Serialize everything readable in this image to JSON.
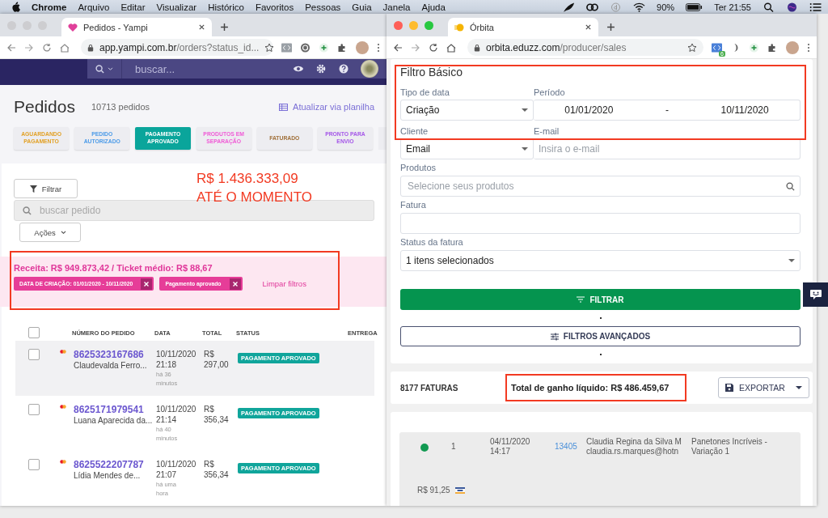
{
  "menu_bar": {
    "app": "Chrome",
    "items": [
      "Arquivo",
      "Editar",
      "Visualizar",
      "Histórico",
      "Favoritos",
      "Pessoas",
      "Guia",
      "Janela",
      "Ajuda"
    ],
    "battery": "90%",
    "clock": "Ter 21:55"
  },
  "left_window": {
    "tab": {
      "title": "Pedidos - Yampi"
    },
    "url": {
      "host": "app.yampi.com.br",
      "path": "/orders?status_id..."
    },
    "header": {
      "search_placeholder": "buscar..."
    },
    "page": {
      "title": "Pedidos",
      "count": "10713 pedidos",
      "sheet_link": "Atualizar via planilha"
    },
    "status_tabs": [
      {
        "label": "AGUARDANDO PAGAMENTO",
        "color": "#e2a126",
        "selected": false
      },
      {
        "label": "PEDIDO AUTORIZADO",
        "color": "#4c9be8",
        "selected": false
      },
      {
        "label": "PAGAMENTO APROVADO",
        "color": "#0aa59b",
        "selected": true
      },
      {
        "label": "PRODUTOS EM SEPARAÇÃO",
        "color": "#f05ad6",
        "selected": false
      },
      {
        "label": "FATURADO",
        "color": "#a0703a",
        "selected": false
      },
      {
        "label": "PRONTO PARA ENVIO",
        "color": "#a455e8",
        "selected": false
      }
    ],
    "filter_button": "Filtrar",
    "search": {
      "placeholder": "buscar pedido"
    },
    "actions_button": "Ações",
    "summary": {
      "text": "Receita: R$ 949.873,42 / Ticket médio: R$ 88,67",
      "chips": [
        "DATA DE CRIAÇÃO: 01/01/2020 - 10/11/2020",
        "Pagamento aprovado"
      ],
      "clear": "Limpar filtros"
    },
    "table": {
      "columns": [
        "NÚMERO DO PEDIDO",
        "DATA",
        "TOTAL",
        "STATUS",
        "ENTREGA"
      ],
      "all_checked": false,
      "rows": [
        {
          "number": "8625323167686",
          "customer": "Claudevalda Ferro...",
          "date": "10/11/2020",
          "time": "21:18",
          "ago": "há 36 minutos",
          "currency": "R$",
          "total": "297,00",
          "status": "PAGAMENTO APROVADO",
          "checked": false,
          "highlighted": true
        },
        {
          "number": "8625171979541",
          "customer": "Luana Aparecida da...",
          "date": "10/11/2020",
          "time": "21:14",
          "ago": "há 40 minutos",
          "currency": "R$",
          "total": "356,34",
          "status": "PAGAMENTO APROVADO",
          "checked": false,
          "highlighted": false
        },
        {
          "number": "8625522207787",
          "customer": "Lídia Mendes de...",
          "date": "10/11/2020",
          "time": "21:07",
          "ago": "há uma hora",
          "currency": "R$",
          "total": "356,34",
          "status": "PAGAMENTO APROVADO",
          "checked": false,
          "highlighted": false
        }
      ]
    },
    "annotation": [
      "R$ 1.436.333,09",
      "ATÉ O MOMENTO"
    ]
  },
  "right_window": {
    "tab": {
      "title": "Órbita"
    },
    "url": {
      "host": "orbita.eduzz.com",
      "path": "/producer/sales"
    },
    "extension_badge": "6",
    "filter": {
      "title": "Filtro Básico",
      "date_type": {
        "label": "Tipo de data",
        "value": "Criação"
      },
      "period": {
        "label": "Período",
        "start": "01/01/2020",
        "separator": "-",
        "end": "10/11/2020"
      },
      "client": {
        "label": "Cliente",
        "value": "Email"
      },
      "email": {
        "label": "E-mail",
        "placeholder": "Insira o e-mail"
      },
      "products": {
        "label": "Produtos",
        "placeholder": "Selecione seus produtos"
      },
      "invoice": {
        "label": "Fatura"
      },
      "invoice_status": {
        "label": "Status da fatura",
        "value": "1 itens selecionados"
      },
      "filter_button": "FILTRAR",
      "advanced_button": "FILTROS AVANÇADOS"
    },
    "summary": {
      "count": "8177 FATURAS",
      "total": "Total de ganho líquido: R$ 486.459,67",
      "export_button": "EXPORTAR"
    },
    "invoices": [
      {
        "color": "#129a52",
        "installments": "1",
        "date": "04/11/2020",
        "time": "14:17",
        "id": "13405",
        "name": "Claudia Regina da Silva M",
        "email": "claudia.rs.marques@hotn",
        "product": "Panetones Incríveis - Variação 1",
        "value": "R$ 91,25"
      }
    ]
  }
}
